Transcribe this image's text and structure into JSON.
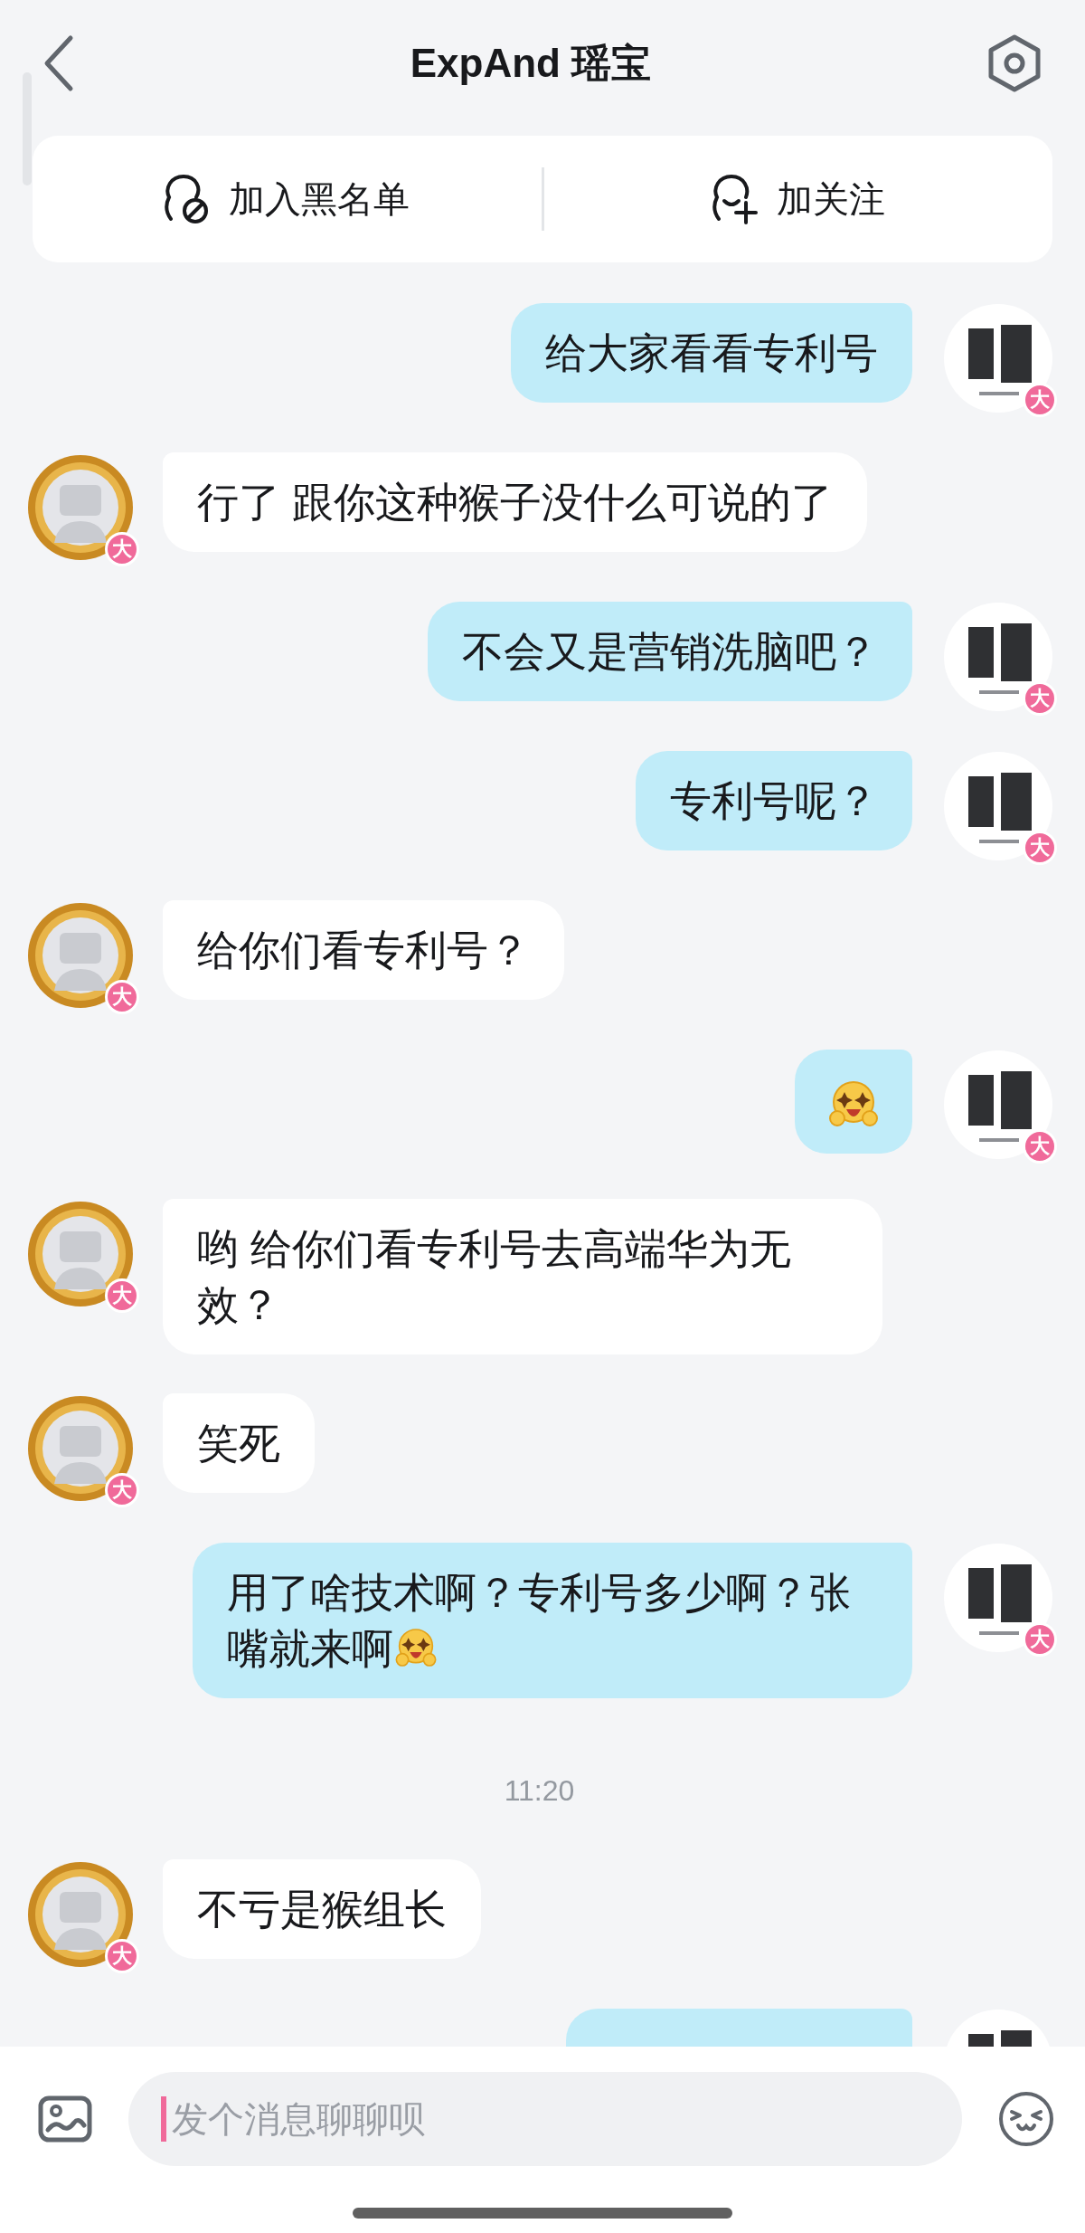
{
  "header": {
    "title": "ExpAnd 瑶宝"
  },
  "actions": [
    {
      "kind": "block",
      "label": "加入黑名单"
    },
    {
      "kind": "follow",
      "label": "加关注"
    }
  ],
  "messages": [
    {
      "kind": "text",
      "mine": true,
      "text": "给大家看看专利号",
      "badge": "大"
    },
    {
      "kind": "text",
      "mine": false,
      "text": "行了 跟你这种猴子没什么可说的了",
      "badge": "大"
    },
    {
      "kind": "text",
      "mine": true,
      "text": "不会又是营销洗脑吧？",
      "badge": "大"
    },
    {
      "kind": "text",
      "mine": true,
      "text": "专利号呢？",
      "badge": "大"
    },
    {
      "kind": "text",
      "mine": false,
      "text": "给你们看专利号？",
      "badge": "大"
    },
    {
      "kind": "emoji",
      "mine": true,
      "badge": "大"
    },
    {
      "kind": "text",
      "mine": false,
      "text": "哟 给你们看专利号去高端华为无效？",
      "badge": "大"
    },
    {
      "kind": "text",
      "mine": false,
      "text": "笑死",
      "badge": "大"
    },
    {
      "kind": "text",
      "mine": true,
      "text": "用了啥技术啊？专利号多少啊？张嘴就来啊",
      "trailing_emoji": true,
      "badge": "大"
    },
    {
      "kind": "time",
      "text": "11:20"
    },
    {
      "kind": "text",
      "mine": false,
      "text": "不亏是猴组长",
      "badge": "大"
    },
    {
      "kind": "partial",
      "mine": true
    }
  ],
  "composer": {
    "placeholder": "发个消息聊聊呗"
  }
}
